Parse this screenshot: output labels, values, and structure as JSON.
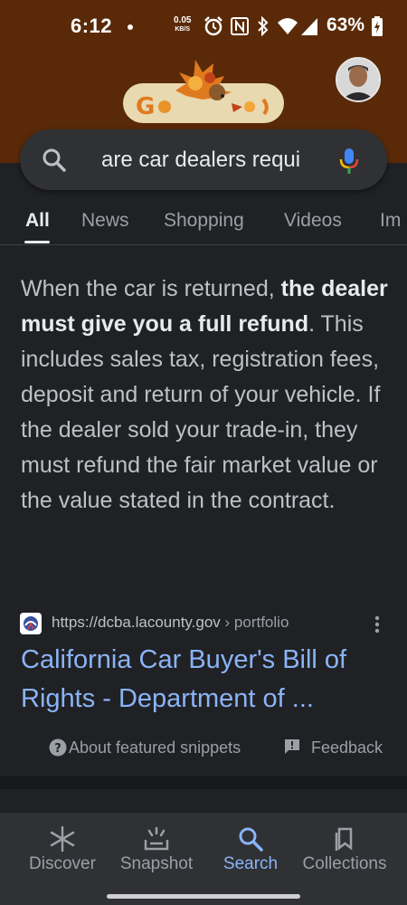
{
  "status_bar": {
    "time": "6:12",
    "net_speed_value": "0.05",
    "net_speed_unit": "KB/S",
    "battery": "63%"
  },
  "header": {
    "doodle_icon": "google-doodle-autumn-hedgehog",
    "avatar_icon": "user-avatar"
  },
  "search": {
    "query": "are car dealers requi",
    "search_icon": "search-icon",
    "mic_icon": "mic-icon"
  },
  "tabs": [
    {
      "label": "All",
      "active": true
    },
    {
      "label": "News",
      "active": false
    },
    {
      "label": "Shopping",
      "active": false
    },
    {
      "label": "Videos",
      "active": false
    },
    {
      "label": "Im",
      "active": false
    }
  ],
  "snippet": {
    "part1": "When the car is returned, ",
    "bold": "the dealer must give you a full refund",
    "part2": ". This includes sales tax, registration fees, deposit and return of your vehicle. If the dealer sold your trade-in, they must refund the fair market value or the value stated in the contract."
  },
  "result": {
    "url": "https://dcba.lacounty.gov",
    "breadcrumb": " › portfolio",
    "title": "California Car Buyer's Bill of Rights - Department of ..."
  },
  "footer_links": {
    "about": "About featured snippets",
    "feedback": "Feedback"
  },
  "bottom_nav": [
    {
      "label": "Discover",
      "icon": "asterisk-icon",
      "active": false
    },
    {
      "label": "Snapshot",
      "icon": "snapshot-icon",
      "active": false
    },
    {
      "label": "Search",
      "icon": "search-icon",
      "active": true
    },
    {
      "label": "Collections",
      "icon": "collections-icon",
      "active": false
    }
  ],
  "colors": {
    "header_brown": "#5a2a08",
    "background": "#202124",
    "link_blue": "#8ab4f8",
    "mic_blue": "#4285f4",
    "mic_red": "#ea4335",
    "mic_yellow": "#fbbc04",
    "mic_green": "#34a853"
  }
}
